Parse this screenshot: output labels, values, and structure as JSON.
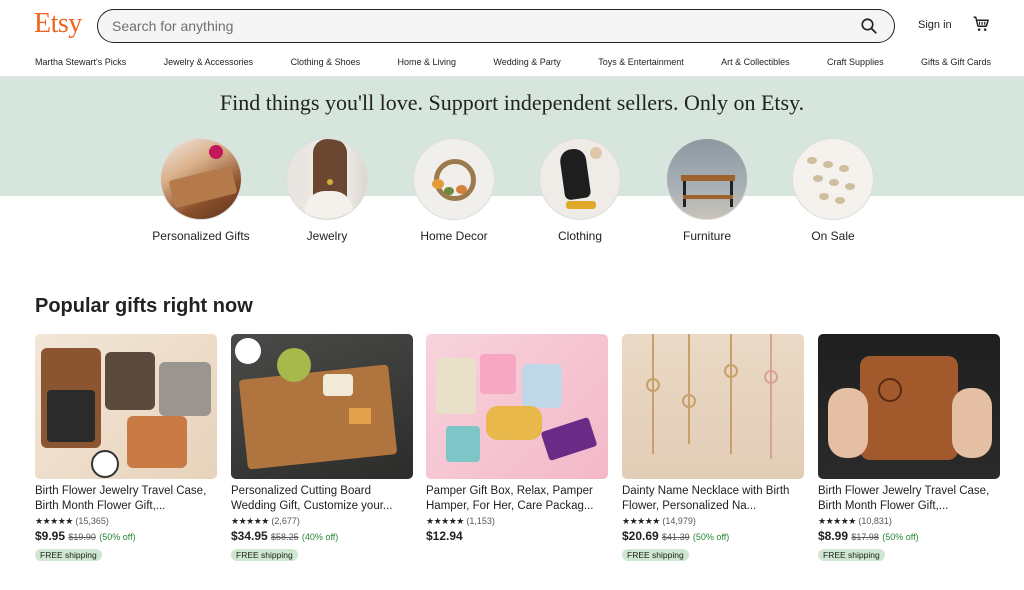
{
  "header": {
    "logo": "Etsy",
    "search_placeholder": "Search for anything",
    "signin_label": "Sign in"
  },
  "nav": {
    "items": [
      "Martha Stewart's Picks",
      "Jewelry & Accessories",
      "Clothing & Shoes",
      "Home & Living",
      "Wedding & Party",
      "Toys & Entertainment",
      "Art & Collectibles",
      "Craft Supplies",
      "Gifts & Gift Cards"
    ]
  },
  "hero": {
    "title": "Find things you'll love. Support independent sellers. Only on Etsy."
  },
  "categories": [
    {
      "label": "Personalized Gifts"
    },
    {
      "label": "Jewelry"
    },
    {
      "label": "Home Decor"
    },
    {
      "label": "Clothing"
    },
    {
      "label": "Furniture"
    },
    {
      "label": "On Sale"
    }
  ],
  "popular": {
    "title": "Popular gifts right now",
    "items": [
      {
        "title": "Birth Flower Jewelry Travel Case, Birth Month Flower Gift,...",
        "stars": "★★★★★",
        "reviews": "(15,365)",
        "price": "$9.95",
        "was": "$19.90",
        "off": "(50% off)",
        "badge": "FREE shipping"
      },
      {
        "title": "Personalized Cutting Board Wedding Gift, Customize your...",
        "stars": "★★★★★",
        "reviews": "(2,677)",
        "price": "$34.95",
        "was": "$58.25",
        "off": "(40% off)",
        "badge": "FREE shipping"
      },
      {
        "title": "Pamper Gift Box, Relax, Pamper Hamper, For Her, Care Packag...",
        "stars": "★★★★★",
        "reviews": "(1,153)",
        "price": "$12.94",
        "was": "",
        "off": "",
        "badge": ""
      },
      {
        "title": "Dainty Name Necklace with Birth Flower, Personalized Na...",
        "stars": "★★★★★",
        "reviews": "(14,979)",
        "price": "$20.69",
        "was": "$41.39",
        "off": "(50% off)",
        "badge": "FREE shipping"
      },
      {
        "title": "Birth Flower Jewelry Travel Case, Birth Month Flower Gift,...",
        "stars": "★★★★★",
        "reviews": "(10,831)",
        "price": "$8.99",
        "was": "$17.98",
        "off": "(50% off)",
        "badge": "FREE shipping"
      }
    ]
  },
  "colors": {
    "brand": "#f1641e",
    "hero_bg": "#d7e6dc",
    "sale_green": "#258635",
    "badge_bg": "#cfe6d0"
  },
  "icons": [
    "search-icon",
    "cart-icon"
  ]
}
